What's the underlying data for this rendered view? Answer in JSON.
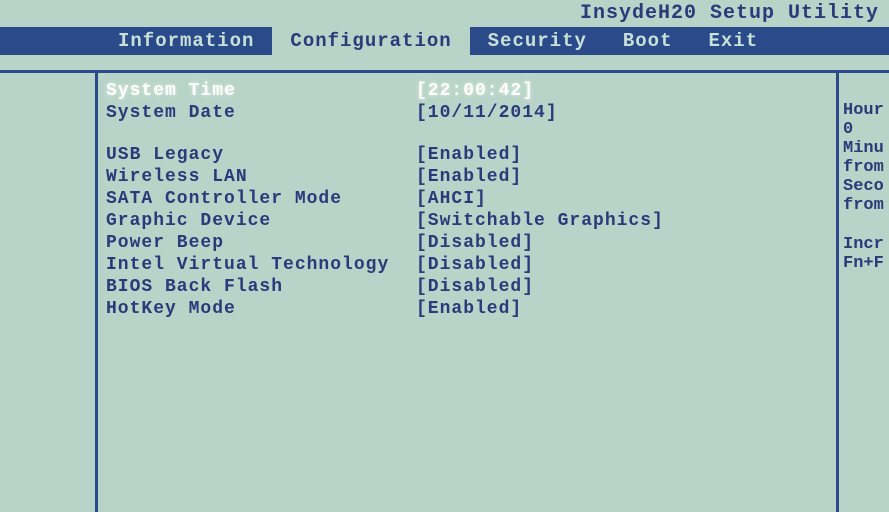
{
  "title": "InsydeH20 Setup Utility",
  "tabs": [
    {
      "label": "Information",
      "active": false
    },
    {
      "label": "Configuration",
      "active": true
    },
    {
      "label": "Security",
      "active": false
    },
    {
      "label": "Boot",
      "active": false
    },
    {
      "label": "Exit",
      "active": false
    }
  ],
  "settings": {
    "system_time": {
      "label": "System Time",
      "value": "[22:00:42]",
      "selected": true
    },
    "system_date": {
      "label": "System Date",
      "value": "[10/11/2014]"
    },
    "usb_legacy": {
      "label": "USB Legacy",
      "value": "[Enabled]"
    },
    "wireless_lan": {
      "label": "Wireless LAN",
      "value": "[Enabled]"
    },
    "sata_controller": {
      "label": "SATA Controller Mode",
      "value": "[AHCI]"
    },
    "graphic_device": {
      "label": "Graphic Device",
      "value": "[Switchable Graphics]"
    },
    "power_beep": {
      "label": "Power Beep",
      "value": "[Disabled]"
    },
    "intel_vt": {
      "label": "Intel Virtual Technology",
      "value": "[Disabled]"
    },
    "bios_back_flash": {
      "label": "BIOS Back Flash",
      "value": "[Disabled]"
    },
    "hotkey_mode": {
      "label": "HotKey Mode",
      "value": "[Enabled]"
    }
  },
  "help": {
    "line1": "Hour",
    "line2": " 0 ",
    "line3": "Minu",
    "line4": "from",
    "line5": "Seco",
    "line6": "from",
    "line7": "Incr",
    "line8": "Fn+F"
  }
}
